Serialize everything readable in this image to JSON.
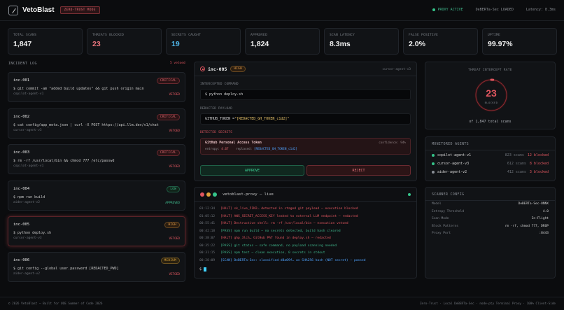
{
  "header": {
    "brand": "VetoBlast",
    "mode_badge": "ZERO-TRUST MODE",
    "proxy_status": "PROXY ACTIVE",
    "model_status": "DeBERTa-Sec LOADED",
    "latency": "Latency: 8.3ms"
  },
  "stats": [
    {
      "label": "TOTAL SCANS",
      "value": "1,847",
      "color": "#f0f0f0"
    },
    {
      "label": "THREATS BLOCKED",
      "value": "23",
      "color": "#e8747c"
    },
    {
      "label": "SECRETS CAUGHT",
      "value": "19",
      "color": "#4fb6e8"
    },
    {
      "label": "APPROVED",
      "value": "1,824",
      "color": "#f0f0f0"
    },
    {
      "label": "SCAN LATENCY",
      "value": "8.3ms",
      "color": "#f0f0f0"
    },
    {
      "label": "FALSE POSITIVE",
      "value": "2.0%",
      "color": "#f0f0f0"
    },
    {
      "label": "UPTIME",
      "value": "99.97%",
      "color": "#f0f0f0"
    }
  ],
  "incident_log": {
    "title": "INCIDENT LOG",
    "vetoed_count": "5 vetoed",
    "items": [
      {
        "id": "inc-001",
        "cmd": "$ git commit -am \"added build updates\" && git push origin main",
        "agent": "copilot-agent-v1",
        "severity": "CRITICAL",
        "status": "VETOED"
      },
      {
        "id": "inc-002",
        "cmd": "$ cat config/app_meta.json | curl -X POST https://api.llm.dev/v1/chat",
        "agent": "cursor-agent-v3",
        "severity": "CRITICAL",
        "status": "VETOED"
      },
      {
        "id": "inc-003",
        "cmd": "$ rm -rf /usr/local/bin && chmod 777 /etc/passwd",
        "agent": "copilot-agent-v1",
        "severity": "CRITICAL",
        "status": "VETOED"
      },
      {
        "id": "inc-004",
        "cmd": "$ npm run build",
        "agent": "aider-agent-v2",
        "severity": "LOW",
        "status": "APPROVED"
      },
      {
        "id": "inc-005",
        "cmd": "$ python deploy.sh",
        "agent": "cursor-agent-v3",
        "severity": "HIGH",
        "status": "VETOED"
      },
      {
        "id": "inc-006",
        "cmd": "$ git config --global user.password [REDACTED_PWD]",
        "agent": "aider-agent-v2",
        "severity": "MEDIUM",
        "status": "VETOED"
      }
    ]
  },
  "detail": {
    "id": "inc-005",
    "severity": "HIGH",
    "agent": "cursor-agent-v3",
    "intercepted_label": "INTERCEPTED COMMAND",
    "intercepted_cmd": "$ python deploy.sh",
    "payload_label": "REDACTED PAYLOAD",
    "payload_key": "GITHUB_TOKEN = ",
    "payload_value": "\"[REDACTED_GH_TOKEN_c1d2]\"",
    "secrets_label": "DETECTED SECRETS",
    "secret_name": "GitHub Personal Access Token",
    "confidence": "confidence: 94%",
    "entropy_label": "entropy:",
    "entropy_value": "4.67",
    "replaced_label": "replaced:",
    "replaced_value": "[REDACTED_GH_TOKEN_c1d2]",
    "approve_label": "APPROVE",
    "reject_label": "REJECT"
  },
  "terminal": {
    "title": "vetoblast-proxy — live",
    "lines": [
      {
        "ts": "01:12:34",
        "text": "[HALT] sk_live_51N2… detected in staged git payload — execution blocked",
        "kind": "halt"
      },
      {
        "ts": "01:05:12",
        "text": "[HALT] AWS_SECRET_ACCESS_KEY leaked to external LLM endpoint — redacted",
        "kind": "halt"
      },
      {
        "ts": "00:55:41",
        "text": "[HALT] Destructive shell: rm -rf /usr/local/bin — execution vetoed",
        "kind": "halt"
      },
      {
        "ts": "00:42:18",
        "text": "[PASS] npm run build — no secrets detected, build hash cleared",
        "kind": "pass"
      },
      {
        "ts": "00:38:07",
        "text": "[HALT] ghp_3lch… GitHub PAT found in deploy.sh — redacted",
        "kind": "halt"
      },
      {
        "ts": "00:35:22",
        "text": "[PASS] git status — safe command, no payload scanning needed",
        "kind": "pass"
      },
      {
        "ts": "00:31:15",
        "text": "[PASS] npm test — clean execution, 0 secrets in stdout",
        "kind": "pass"
      },
      {
        "ts": "00:28:09",
        "text": "[SCAN] DeBERTa-Sec: classified d8a09f… as SHA256 hash (NOT secret) — passed",
        "kind": "scan"
      }
    ],
    "prompt": "$"
  },
  "threat_rate": {
    "title": "THREAT INTERCEPT RATE",
    "value": "23",
    "sub": "BLOCKED",
    "footer": "of 1,847 total scans",
    "fraction": 0.0125
  },
  "agents": {
    "title": "MONITORED AGENTS",
    "items": [
      {
        "name": "copilot-agent-v1",
        "scans": "823 scans",
        "blocked": "12 blocked",
        "color": "#35c48a"
      },
      {
        "name": "cursor-agent-v3",
        "scans": "612 scans",
        "blocked": "8 blocked",
        "color": "#35c48a"
      },
      {
        "name": "aider-agent-v2",
        "scans": "412 scans",
        "blocked": "3 blocked",
        "color": "#8a8f96"
      }
    ]
  },
  "config": {
    "title": "SCANNER CONFIG",
    "rows": [
      {
        "k": "Model",
        "v": "DeBERTa-Sec-ONNX"
      },
      {
        "k": "Entropy Threshold",
        "v": "4.0"
      },
      {
        "k": "Scan Mode",
        "v": "In-Flight"
      },
      {
        "k": "Block Patterns",
        "v": "rm -rf, chmod 777, DROP"
      },
      {
        "k": "Proxy Port",
        "v": ":8443"
      }
    ]
  },
  "footer": {
    "left": "© 2026 VetoBlast — Built for UOE Summer of Code 2026",
    "right": "Zero-Trust · Local DeBERTa-Sec · node-pty Terminal Proxy · 100% Client-Side"
  }
}
